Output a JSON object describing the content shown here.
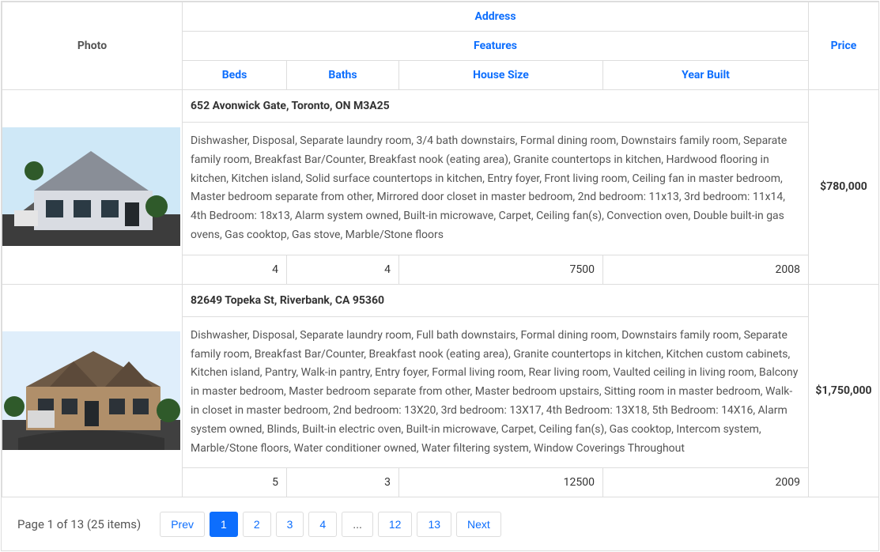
{
  "headers": {
    "photo": "Photo",
    "address": "Address",
    "features": "Features",
    "beds": "Beds",
    "baths": "Baths",
    "size": "House Size",
    "year": "Year Built",
    "price": "Price"
  },
  "rows": [
    {
      "address": "652 Avonwick Gate, Toronto, ON M3A25",
      "features": "Dishwasher, Disposal, Separate laundry room, 3/4 bath downstairs, Formal dining room, Downstairs family room, Separate family room, Breakfast Bar/Counter, Breakfast nook (eating area), Granite countertops in kitchen, Hardwood flooring in kitchen, Kitchen island, Solid surface countertops in kitchen, Entry foyer, Front living room, Ceiling fan in master bedroom, Master bedroom separate from other, Mirrored door closet in master bedroom, 2nd bedroom: 11x13, 3rd bedroom: 11x14, 4th Bedroom: 18x13, Alarm system owned, Built-in microwave, Carpet, Ceiling fan(s), Convection oven, Double built-in gas ovens, Gas cooktop, Gas stove, Marble/Stone floors",
      "beds": "4",
      "baths": "4",
      "size": "7500",
      "year": "2008",
      "price": "$780,000"
    },
    {
      "address": "82649 Topeka St, Riverbank, CA 95360",
      "features": "Dishwasher, Disposal, Separate laundry room, Full bath downstairs, Formal dining room, Downstairs family room, Separate family room, Breakfast Bar/Counter, Breakfast nook (eating area), Granite countertops in kitchen, Kitchen custom cabinets, Kitchen island, Pantry, Walk-in pantry, Entry foyer, Formal living room, Rear living room, Vaulted ceiling in living room, Balcony in master bedroom, Master bedroom separate from other, Master bedroom upstairs, Sitting room in master bedroom, Walk-in closet in master bedroom, 2nd bedroom: 13X20, 3rd bedroom: 13X17, 4th Bedroom: 13X18, 5th Bedroom: 14X16, Alarm system owned, Blinds, Built-in electric oven, Built-in microwave, Carpet, Ceiling fan(s), Gas cooktop, Intercom system, Marble/Stone floors, Water conditioner owned, Water filtering system, Window Coverings Throughout",
      "beds": "5",
      "baths": "3",
      "size": "12500",
      "year": "2009",
      "price": "$1,750,000"
    }
  ],
  "pager": {
    "info": "Page 1 of 13 (25 items)",
    "prev": "Prev",
    "next": "Next",
    "pages": [
      "1",
      "2",
      "3",
      "4",
      "...",
      "12",
      "13"
    ],
    "active": "1"
  }
}
